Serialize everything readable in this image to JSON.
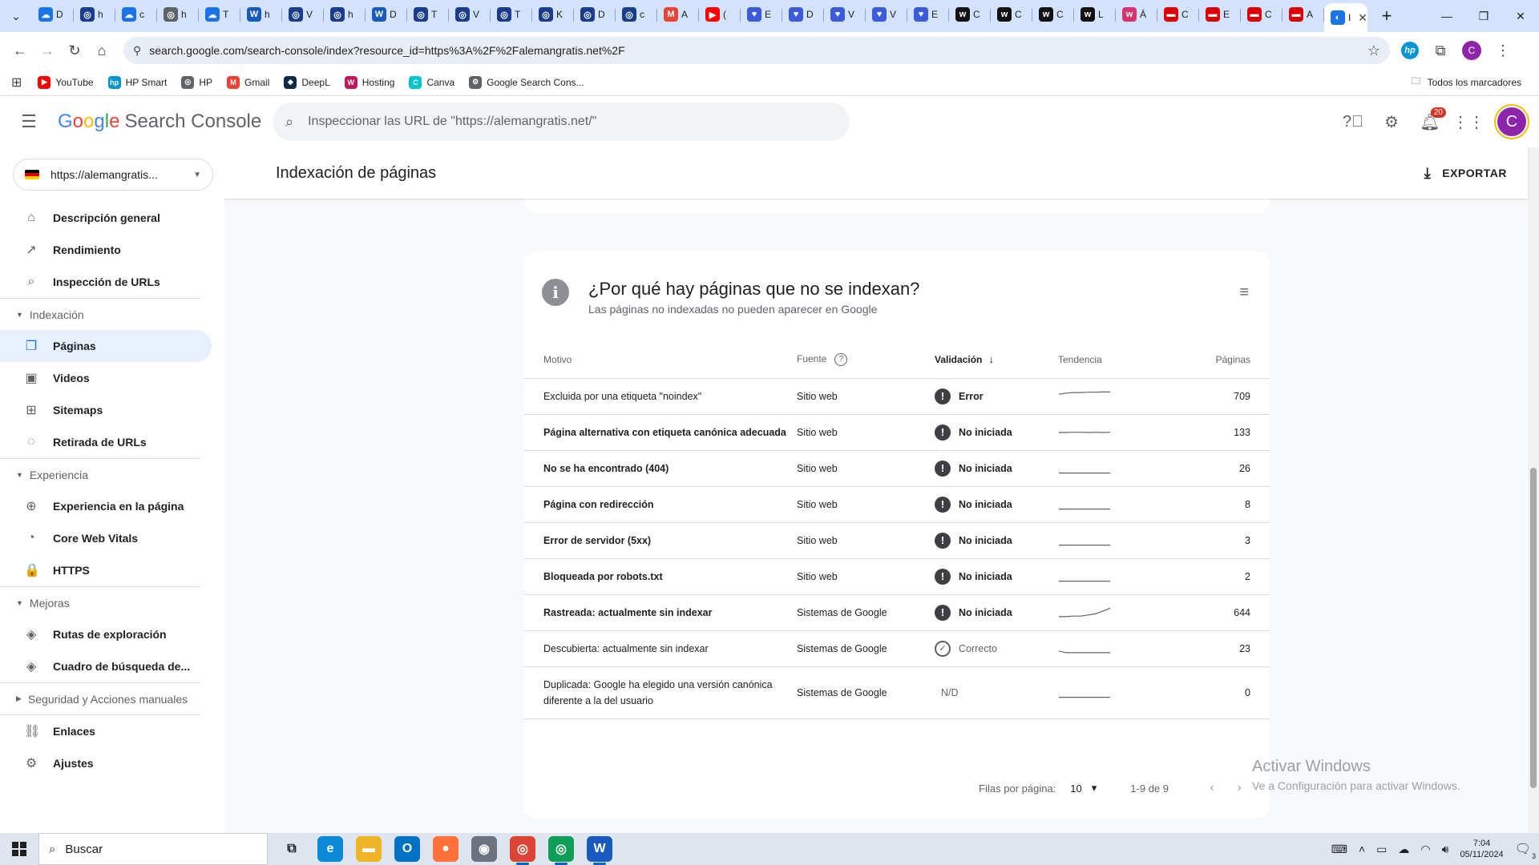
{
  "browser": {
    "tabs": [
      {
        "icon": "cloud-icon",
        "color": "#1a73e8",
        "title": "D"
      },
      {
        "icon": "circle-icon",
        "color": "#1a3d8f",
        "title": "h"
      },
      {
        "icon": "cloud-icon",
        "color": "#1a73e8",
        "title": "c"
      },
      {
        "icon": "circle-icon",
        "color": "#5f6368",
        "title": "h"
      },
      {
        "icon": "cloud-icon",
        "color": "#1a73e8",
        "title": "T"
      },
      {
        "icon": "word-icon",
        "color": "#185abd",
        "title": "h"
      },
      {
        "icon": "circle-icon",
        "color": "#1a3d8f",
        "title": "V"
      },
      {
        "icon": "circle-icon",
        "color": "#1a3d8f",
        "title": "h"
      },
      {
        "icon": "word-icon",
        "color": "#185abd",
        "title": "D"
      },
      {
        "icon": "circle-icon",
        "color": "#1a3d8f",
        "title": "T"
      },
      {
        "icon": "circle-icon",
        "color": "#1a3d8f",
        "title": "V"
      },
      {
        "icon": "circle-icon",
        "color": "#1a3d8f",
        "title": "T"
      },
      {
        "icon": "circle-icon",
        "color": "#1a3d8f",
        "title": "K"
      },
      {
        "icon": "circle-icon",
        "color": "#1a3d8f",
        "title": "D"
      },
      {
        "icon": "circle-icon",
        "color": "#1a3d8f",
        "title": "c"
      },
      {
        "icon": "gmail-icon",
        "color": "#ea4335",
        "title": "A"
      },
      {
        "icon": "youtube-icon",
        "color": "#ff0000",
        "title": "("
      },
      {
        "icon": "heart-icon",
        "color": "#3b5bdb",
        "title": "E"
      },
      {
        "icon": "heart-icon",
        "color": "#3b5bdb",
        "title": "D"
      },
      {
        "icon": "heart-icon",
        "color": "#3b5bdb",
        "title": "V"
      },
      {
        "icon": "heart-icon",
        "color": "#3b5bdb",
        "title": "V"
      },
      {
        "icon": "heart-icon",
        "color": "#3b5bdb",
        "title": "E"
      },
      {
        "icon": "w-icon",
        "color": "#111111",
        "title": "C"
      },
      {
        "icon": "w-icon",
        "color": "#111111",
        "title": "C"
      },
      {
        "icon": "w-icon",
        "color": "#111111",
        "title": "C"
      },
      {
        "icon": "w-icon",
        "color": "#111111",
        "title": "L"
      },
      {
        "icon": "w-icon",
        "color": "#d6336c",
        "title": "Á"
      },
      {
        "icon": "flag-icon",
        "color": "#dd0000",
        "title": "C"
      },
      {
        "icon": "flag-icon",
        "color": "#dd0000",
        "title": "E"
      },
      {
        "icon": "flag-icon",
        "color": "#dd0000",
        "title": "C"
      },
      {
        "icon": "flag-icon",
        "color": "#dd0000",
        "title": "A"
      }
    ],
    "active_tab": {
      "icon": "search-console-icon",
      "color": "#1a73e8",
      "title": "I"
    },
    "url": "search.google.com/search-console/index?resource_id=https%3A%2F%2Falemangratis.net%2F",
    "bookmarks": [
      {
        "label": "YouTube",
        "icon": "youtube-icon",
        "color": "#ff0000",
        "glyph": "▶"
      },
      {
        "label": "HP Smart",
        "icon": "hp-icon",
        "color": "#0096d6",
        "glyph": "hp"
      },
      {
        "label": "HP",
        "icon": "globe-icon",
        "color": "#5f6368",
        "glyph": "◎"
      },
      {
        "label": "Gmail",
        "icon": "gmail-icon",
        "color": "#ea4335",
        "glyph": "M"
      },
      {
        "label": "DeepL",
        "icon": "deepl-icon",
        "color": "#0f2b46",
        "glyph": "◆"
      },
      {
        "label": "Hosting",
        "icon": "hosting-icon",
        "color": "#c2185b",
        "glyph": "W"
      },
      {
        "label": "Canva",
        "icon": "canva-icon",
        "color": "#00c4cc",
        "glyph": "C"
      },
      {
        "label": "Google Search Cons...",
        "icon": "search-console-icon",
        "color": "#5f6368",
        "glyph": "⚙"
      }
    ],
    "all_bookmarks": "Todos los marcadores",
    "profile_initial": "C"
  },
  "gsc": {
    "logo_google": [
      "G",
      "o",
      "o",
      "g",
      "l",
      "e"
    ],
    "logo_product": "Search Console",
    "search_placeholder": "Inspeccionar las URL de \"https://alemangratis.net/\"",
    "notifications_count": "20",
    "avatar_initial": "C",
    "property": "https://alemangratis...",
    "nav": {
      "top": [
        {
          "label": "Descripción general",
          "icon": "home-icon",
          "glyph": "⌂"
        },
        {
          "label": "Rendimiento",
          "icon": "trending-up-icon",
          "glyph": "↗"
        },
        {
          "label": "Inspección de URLs",
          "icon": "search-icon",
          "glyph": "⌕"
        }
      ],
      "indexacion_title": "Indexación",
      "indexacion": [
        {
          "label": "Páginas",
          "icon": "pages-icon",
          "glyph": "❐",
          "active": true
        },
        {
          "label": "Videos",
          "icon": "video-icon",
          "glyph": "▣"
        },
        {
          "label": "Sitemaps",
          "icon": "sitemap-icon",
          "glyph": "⊞"
        },
        {
          "label": "Retirada de URLs",
          "icon": "eye-off-icon",
          "glyph": "◌"
        }
      ],
      "experiencia_title": "Experiencia",
      "experiencia": [
        {
          "label": "Experiencia en la página",
          "icon": "plus-circle-icon",
          "glyph": "⊕"
        },
        {
          "label": "Core Web Vitals",
          "icon": "speed-icon",
          "glyph": "◔"
        },
        {
          "label": "HTTPS",
          "icon": "lock-icon",
          "glyph": "🔒"
        }
      ],
      "mejoras_title": "Mejoras",
      "mejoras": [
        {
          "label": "Rutas de exploración",
          "icon": "layers-icon",
          "glyph": "◈"
        },
        {
          "label": "Cuadro de búsqueda de...",
          "icon": "layers-icon",
          "glyph": "◈"
        }
      ],
      "seguridad_title": "Seguridad y Acciones manuales",
      "bottom": [
        {
          "label": "Enlaces",
          "icon": "links-icon",
          "glyph": "⛓"
        },
        {
          "label": "Ajustes",
          "icon": "settings-icon",
          "glyph": "⚙"
        }
      ]
    },
    "page_title": "Indexación de páginas",
    "export_label": "EXPORTAR",
    "card": {
      "title": "¿Por qué hay páginas que no se indexan?",
      "subtitle": "Las páginas no indexadas no pueden aparecer en Google",
      "columns": {
        "motivo": "Motivo",
        "fuente": "Fuente",
        "validacion": "Validación",
        "tendencia": "Tendencia",
        "paginas": "Páginas"
      },
      "rows": [
        {
          "motivo": "Excluida por una etiqueta \"noindex\"",
          "fuente": "Sitio web",
          "validacion": "Error",
          "status": "error",
          "bold": false,
          "trend": [
            0.3,
            0.2,
            0.15,
            0.15,
            0.12,
            0.12,
            0.1,
            0.1
          ],
          "paginas": "709"
        },
        {
          "motivo": "Página alternativa con etiqueta canónica adecuada",
          "fuente": "Sitio web",
          "validacion": "No iniciada",
          "status": "pending",
          "bold": true,
          "trend": [
            0.5,
            0.5,
            0.48,
            0.48,
            0.5,
            0.48,
            0.5,
            0.48
          ],
          "paginas": "133"
        },
        {
          "motivo": "No se ha encontrado (404)",
          "fuente": "Sitio web",
          "validacion": "No iniciada",
          "status": "pending",
          "bold": true,
          "trend": [
            0.9,
            0.9,
            0.9,
            0.9,
            0.9,
            0.9,
            0.9,
            0.9
          ],
          "paginas": "26"
        },
        {
          "motivo": "Página con redirección",
          "fuente": "Sitio web",
          "validacion": "No iniciada",
          "status": "pending",
          "bold": true,
          "trend": [
            0.9,
            0.9,
            0.9,
            0.9,
            0.9,
            0.9,
            0.9,
            0.9
          ],
          "paginas": "8"
        },
        {
          "motivo": "Error de servidor (5xx)",
          "fuente": "Sitio web",
          "validacion": "No iniciada",
          "status": "pending",
          "bold": true,
          "trend": [
            0.9,
            0.9,
            0.9,
            0.9,
            0.9,
            0.9,
            0.9,
            0.9
          ],
          "paginas": "3"
        },
        {
          "motivo": "Bloqueada por robots.txt",
          "fuente": "Sitio web",
          "validacion": "No iniciada",
          "status": "pending",
          "bold": true,
          "trend": [
            0.9,
            0.9,
            0.9,
            0.9,
            0.9,
            0.9,
            0.9,
            0.9
          ],
          "paginas": "2"
        },
        {
          "motivo": "Rastreada: actualmente sin indexar",
          "fuente": "Sistemas de Google",
          "validacion": "No iniciada",
          "status": "pending",
          "bold": true,
          "trend": [
            0.85,
            0.85,
            0.8,
            0.8,
            0.7,
            0.6,
            0.35,
            0.1
          ],
          "paginas": "644"
        },
        {
          "motivo": "Descubierta: actualmente sin indexar",
          "fuente": "Sistemas de Google",
          "validacion": "Correcto",
          "status": "ok",
          "bold": false,
          "trend": [
            0.7,
            0.85,
            0.85,
            0.85,
            0.85,
            0.85,
            0.85,
            0.85
          ],
          "paginas": "23"
        },
        {
          "motivo": "Duplicada: Google ha elegido una versión canónica diferente a la del usuario",
          "fuente": "Sistemas de Google",
          "validacion": "N/D",
          "status": "na",
          "bold": false,
          "trend": [
            0.9,
            0.9,
            0.9,
            0.9,
            0.9,
            0.9,
            0.9,
            0.9
          ],
          "paginas": "0"
        }
      ],
      "rows_per_page_label": "Filas por página:",
      "rows_per_page": "10",
      "range": "1-9 de 9"
    }
  },
  "watermark": {
    "line1": "Activar Windows",
    "line2": "Ve a Configuración para activar Windows."
  },
  "taskbar": {
    "search": "Buscar",
    "apps": [
      {
        "icon": "task-view-icon",
        "color": "transparent",
        "glyph": "⧉",
        "running": false
      },
      {
        "icon": "edge-icon",
        "color": "#0c8ad8",
        "glyph": "e",
        "running": false
      },
      {
        "icon": "folder-icon",
        "color": "#f0b429",
        "glyph": "▬",
        "running": false
      },
      {
        "icon": "outlook-icon",
        "color": "#0072c6",
        "glyph": "O",
        "running": false
      },
      {
        "icon": "firefox-icon",
        "color": "#ff7139",
        "glyph": "●",
        "running": false
      },
      {
        "icon": "camera-icon",
        "color": "#6b7280",
        "glyph": "◉",
        "running": false
      },
      {
        "icon": "chrome-icon",
        "color": "#db4437",
        "glyph": "◎",
        "running": true
      },
      {
        "icon": "chrome-icon",
        "color": "#0f9d58",
        "glyph": "◎",
        "running": true
      },
      {
        "icon": "word-icon",
        "color": "#185abd",
        "glyph": "W",
        "running": true
      }
    ],
    "time": "7:04",
    "date": "05/11/2024",
    "notifications": "3"
  }
}
